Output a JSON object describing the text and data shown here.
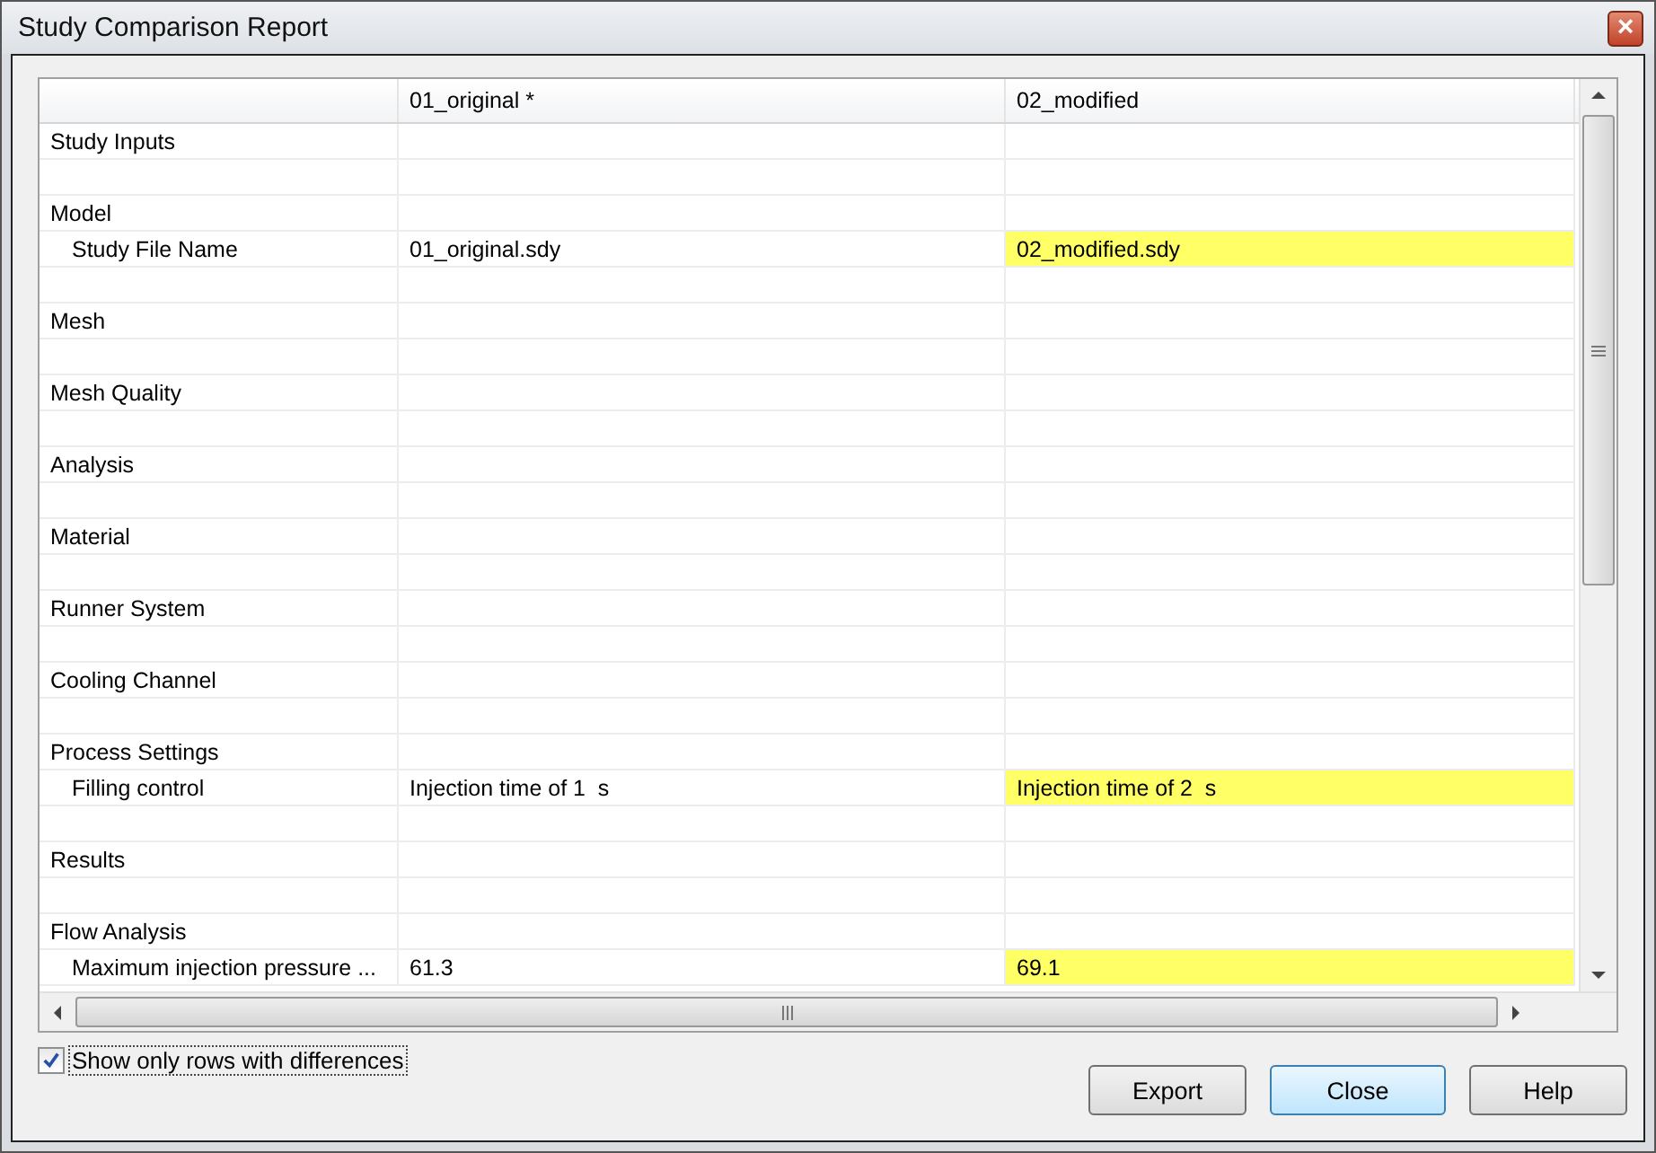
{
  "window": {
    "title": "Study Comparison Report",
    "close_glyph": "×"
  },
  "table": {
    "columns": [
      "01_original *",
      "02_modified"
    ],
    "rows": [
      {
        "kind": "item",
        "label": "Study Inputs",
        "values": [],
        "different": false
      },
      {
        "kind": "blank"
      },
      {
        "kind": "item",
        "label": "Model",
        "values": [],
        "different": false,
        "children": [
          {
            "kind": "item",
            "label": "Study File Name",
            "values": [
              "01_original.sdy",
              "02_modified.sdy"
            ],
            "different": true
          }
        ]
      },
      {
        "kind": "blank"
      },
      {
        "kind": "item",
        "label": "Mesh",
        "values": [],
        "different": false
      },
      {
        "kind": "blank"
      },
      {
        "kind": "item",
        "label": "Mesh Quality",
        "values": [],
        "different": false
      },
      {
        "kind": "blank"
      },
      {
        "kind": "item",
        "label": "Analysis",
        "values": [],
        "different": false
      },
      {
        "kind": "blank"
      },
      {
        "kind": "item",
        "label": "Material",
        "values": [],
        "different": false
      },
      {
        "kind": "blank"
      },
      {
        "kind": "item",
        "label": "Runner System",
        "values": [],
        "different": false
      },
      {
        "kind": "blank"
      },
      {
        "kind": "item",
        "label": "Cooling Channel",
        "values": [],
        "different": false
      },
      {
        "kind": "blank"
      },
      {
        "kind": "item",
        "label": "Process Settings",
        "values": [],
        "different": false,
        "children": [
          {
            "kind": "item",
            "label": "Filling control",
            "values": [
              "Injection time of 1  s",
              "Injection time of 2  s"
            ],
            "different": true
          }
        ]
      },
      {
        "kind": "blank"
      },
      {
        "kind": "item",
        "label": "Results",
        "values": [],
        "different": false
      },
      {
        "kind": "blank"
      },
      {
        "kind": "item",
        "label": "Flow Analysis",
        "values": [],
        "different": false,
        "children": [
          {
            "kind": "item",
            "label": "Maximum injection pressure ...",
            "values": [
              "61.3",
              "69.1"
            ],
            "different": true
          }
        ]
      }
    ]
  },
  "show_only_differences": {
    "label": "Show only rows with differences",
    "checked": true
  },
  "buttons": [
    {
      "label": "Export",
      "default": false
    },
    {
      "label": "Close",
      "default": true
    },
    {
      "label": "Help",
      "default": false
    }
  ]
}
